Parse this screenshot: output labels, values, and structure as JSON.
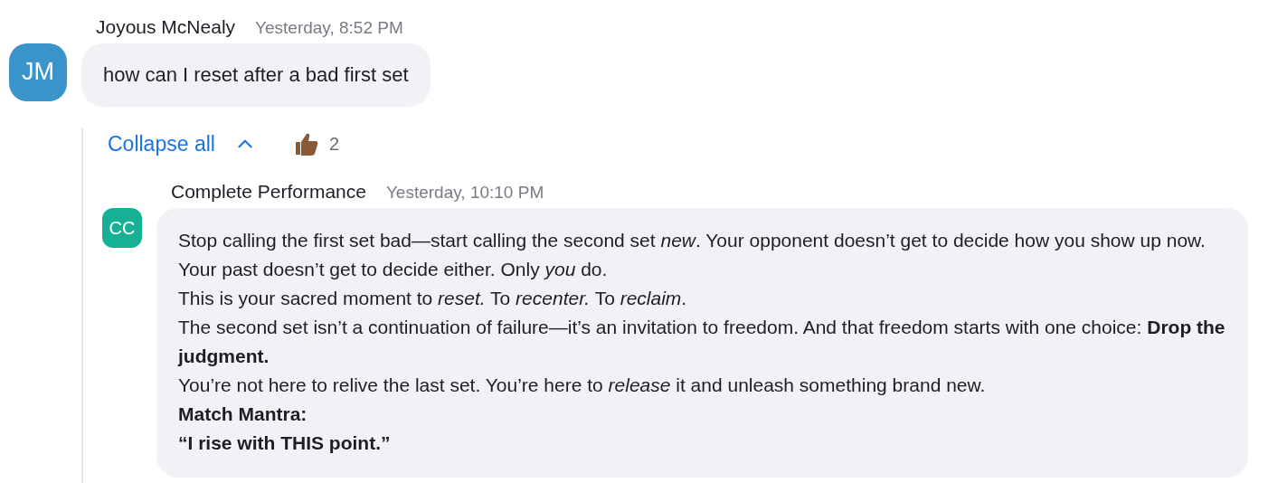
{
  "message": {
    "avatar": "JM",
    "author": "Joyous McNealy",
    "time": "Yesterday, 8:52 PM",
    "text": "how can I reset after a bad first set"
  },
  "thread": {
    "collapse_label": "Collapse all",
    "expanded": true,
    "reactions": [
      {
        "count": "2"
      }
    ]
  },
  "reply": {
    "avatar": "CC",
    "author": "Complete Performance",
    "time": "Yesterday, 10:10 PM",
    "paragraphs": [
      {
        "kind": "plain",
        "text": "Stop calling the first set bad—start calling the second set *new*. Your opponent doesn’t get to decide how you show up now. Your past doesn’t get to decide either. Only *you* do."
      },
      {
        "kind": "plain",
        "text": "This is your sacred moment to *reset.* To *recenter.* To *reclaim*."
      },
      {
        "kind": "plain",
        "text": "The second set isn’t a continuation of failure—it’s an invitation to freedom. And that freedom starts with one choice: **Drop the judgment.**"
      },
      {
        "kind": "plain",
        "text": "You’re not here to relive the last set. You’re here to *release* it and unleash something brand new."
      },
      {
        "kind": "bold",
        "text": "Match Mantra:"
      },
      {
        "kind": "bold",
        "text": "“I rise with THIS point.”"
      }
    ]
  }
}
